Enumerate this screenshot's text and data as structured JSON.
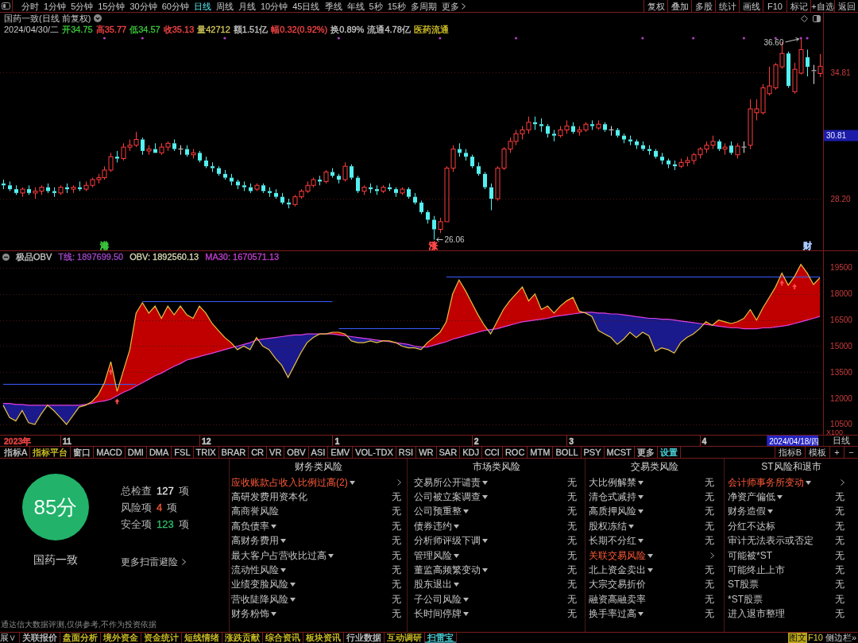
{
  "toolbar": {
    "periods": [
      {
        "label": "分时",
        "selected": false
      },
      {
        "label": "1分钟",
        "selected": false
      },
      {
        "label": "5分钟",
        "selected": false
      },
      {
        "label": "15分钟",
        "selected": false
      },
      {
        "label": "30分钟",
        "selected": false
      },
      {
        "label": "60分钟",
        "selected": false
      },
      {
        "label": "日线",
        "selected": true
      },
      {
        "label": "周线",
        "selected": false
      },
      {
        "label": "月线",
        "selected": false
      },
      {
        "label": "10分钟",
        "selected": false
      },
      {
        "label": "45日线",
        "selected": false
      },
      {
        "label": "季线",
        "selected": false
      },
      {
        "label": "年线",
        "selected": false
      },
      {
        "label": "5秒",
        "selected": false
      },
      {
        "label": "15秒",
        "selected": false
      },
      {
        "label": "多周期",
        "selected": false
      }
    ],
    "more": "更多",
    "actions": [
      "复权",
      "叠加",
      "多股",
      "统计",
      "画线",
      "F10",
      "标记",
      "+自选",
      "返回"
    ]
  },
  "price_panel": {
    "title": "国药一致(日线 前复权)",
    "date": "2024/04/30/二",
    "quote": [
      {
        "text": "开34.75",
        "color": "#3cc83c"
      },
      {
        "text": "高35.77",
        "color": "#ff4646"
      },
      {
        "text": "低34.57",
        "color": "#3cc83c"
      },
      {
        "text": "收35.13",
        "color": "#ff4646"
      },
      {
        "text": "量42712",
        "color": "#d2c85a"
      },
      {
        "text": "额1.51亿",
        "color": "#c8c8c8"
      },
      {
        "text": "幅0.32(0.92%)",
        "color": "#ff4646"
      },
      {
        "text": "换0.89%",
        "color": "#c8c8c8"
      },
      {
        "text": "流通4.78亿",
        "color": "#c8c8c8"
      },
      {
        "text": "医药流通",
        "color": "#d8c828"
      }
    ],
    "event_marks": [
      {
        "label": "港",
        "color": "#3cc83c"
      },
      {
        "label": "涨",
        "color": "#ff4646"
      },
      {
        "label": "财",
        "color": "#a8c8ff"
      }
    ],
    "cursor_price": "30.81",
    "chart_data": {
      "type": "candlestick",
      "ylim": [
        25.5,
        37.93
      ],
      "yticks": [
        {
          "value": 28.2,
          "label": "28.20"
        },
        {
          "value": 34.81,
          "label": "34.81"
        }
      ],
      "grid": true,
      "annotations": [
        "36.60",
        "26.06"
      ],
      "ohlc": [
        [
          29.0,
          29.2,
          28.7,
          28.9
        ],
        [
          28.9,
          29.1,
          28.6,
          28.7
        ],
        [
          28.7,
          28.9,
          28.4,
          28.5
        ],
        [
          28.5,
          28.8,
          28.3,
          28.7
        ],
        [
          28.7,
          28.9,
          28.4,
          28.5
        ],
        [
          28.5,
          28.8,
          28.2,
          28.6
        ],
        [
          28.6,
          28.9,
          28.4,
          28.8
        ],
        [
          28.8,
          29.0,
          28.5,
          28.6
        ],
        [
          28.6,
          28.8,
          28.3,
          28.5
        ],
        [
          28.5,
          28.9,
          28.4,
          28.8
        ],
        [
          28.8,
          29.0,
          28.5,
          28.7
        ],
        [
          28.7,
          28.9,
          28.5,
          28.8
        ],
        [
          28.8,
          29.1,
          28.6,
          28.7
        ],
        [
          28.7,
          29.1,
          28.6,
          28.9
        ],
        [
          28.9,
          29.3,
          28.8,
          29.2
        ],
        [
          29.2,
          29.5,
          29.0,
          29.3
        ],
        [
          29.3,
          29.9,
          29.2,
          29.7
        ],
        [
          29.7,
          30.6,
          29.6,
          30.4
        ],
        [
          30.4,
          30.7,
          30.1,
          30.3
        ],
        [
          30.3,
          31.1,
          30.2,
          30.9
        ],
        [
          30.9,
          31.3,
          30.7,
          31.0
        ],
        [
          31.0,
          31.7,
          30.9,
          31.3
        ],
        [
          31.3,
          31.4,
          30.5,
          30.7
        ],
        [
          30.7,
          31.0,
          30.5,
          30.8
        ],
        [
          30.8,
          31.1,
          30.6,
          30.6
        ],
        [
          30.6,
          31.1,
          30.5,
          30.9
        ],
        [
          30.9,
          31.2,
          30.7,
          31.1
        ],
        [
          31.1,
          31.3,
          30.7,
          30.8
        ],
        [
          30.8,
          31.0,
          30.5,
          30.8
        ],
        [
          30.8,
          31.0,
          30.4,
          30.5
        ],
        [
          30.5,
          30.8,
          30.3,
          30.6
        ],
        [
          30.6,
          30.7,
          30.1,
          30.2
        ],
        [
          30.2,
          30.4,
          29.8,
          29.9
        ],
        [
          29.9,
          30.1,
          29.6,
          29.8
        ],
        [
          29.8,
          29.9,
          29.4,
          29.5
        ],
        [
          29.5,
          29.7,
          29.2,
          29.3
        ],
        [
          29.3,
          29.5,
          28.9,
          29.1
        ],
        [
          29.1,
          29.2,
          28.7,
          28.9
        ],
        [
          28.9,
          29.1,
          28.6,
          28.8
        ],
        [
          28.8,
          29.0,
          28.5,
          28.6
        ],
        [
          28.7,
          29.0,
          28.6,
          28.9
        ],
        [
          28.9,
          29.0,
          28.5,
          28.6
        ],
        [
          28.6,
          28.8,
          28.3,
          28.5
        ],
        [
          28.5,
          28.7,
          28.2,
          28.3
        ],
        [
          28.3,
          28.5,
          27.9,
          28.0
        ],
        [
          28.0,
          28.2,
          27.7,
          27.9
        ],
        [
          27.9,
          28.4,
          27.8,
          28.3
        ],
        [
          28.3,
          28.7,
          28.2,
          28.6
        ],
        [
          28.6,
          29.1,
          28.5,
          28.9
        ],
        [
          28.9,
          29.3,
          28.8,
          29.2
        ],
        [
          29.2,
          29.4,
          28.9,
          29.1
        ],
        [
          29.1,
          29.7,
          29.0,
          29.6
        ],
        [
          29.6,
          29.8,
          29.3,
          29.4
        ],
        [
          29.4,
          29.5,
          29.0,
          29.2
        ],
        [
          29.2,
          30.1,
          29.1,
          29.9
        ],
        [
          29.9,
          30.0,
          29.2,
          29.3
        ],
        [
          29.3,
          29.4,
          28.5,
          28.6
        ],
        [
          28.6,
          28.9,
          28.4,
          28.8
        ],
        [
          28.8,
          29.0,
          28.5,
          28.7
        ],
        [
          28.7,
          28.9,
          28.4,
          28.6
        ],
        [
          28.6,
          28.9,
          28.5,
          28.8
        ],
        [
          28.8,
          29.0,
          28.6,
          28.7
        ],
        [
          28.7,
          28.8,
          28.3,
          28.5
        ],
        [
          28.5,
          28.8,
          28.4,
          28.7
        ],
        [
          28.7,
          28.8,
          28.2,
          28.3
        ],
        [
          28.3,
          28.5,
          27.9,
          28.0
        ],
        [
          28.0,
          28.1,
          27.4,
          27.5
        ],
        [
          27.5,
          27.6,
          26.9,
          27.1
        ],
        [
          27.1,
          27.3,
          26.06,
          26.6
        ],
        [
          26.6,
          27.2,
          26.4,
          27.0
        ],
        [
          27.0,
          29.9,
          27.0,
          29.8
        ],
        [
          29.8,
          31.0,
          29.6,
          30.8
        ],
        [
          30.8,
          31.1,
          30.4,
          30.6
        ],
        [
          30.6,
          30.8,
          30.2,
          30.4
        ],
        [
          30.4,
          30.5,
          29.8,
          29.9
        ],
        [
          29.9,
          30.1,
          29.4,
          29.5
        ],
        [
          29.5,
          29.6,
          28.7,
          28.8
        ],
        [
          28.8,
          29.0,
          27.6,
          28.2
        ],
        [
          28.2,
          29.9,
          28.1,
          29.8
        ],
        [
          29.8,
          30.9,
          29.7,
          30.8
        ],
        [
          30.8,
          31.4,
          30.6,
          31.2
        ],
        [
          31.2,
          31.8,
          31.0,
          31.6
        ],
        [
          31.6,
          32.0,
          31.3,
          31.8
        ],
        [
          31.8,
          32.5,
          31.6,
          32.2
        ],
        [
          32.2,
          32.5,
          31.8,
          32.1
        ],
        [
          32.1,
          32.4,
          31.7,
          32.0
        ],
        [
          32.0,
          32.1,
          31.4,
          31.6
        ],
        [
          31.6,
          31.8,
          31.2,
          31.5
        ],
        [
          31.5,
          32.0,
          31.4,
          31.8
        ],
        [
          31.8,
          32.3,
          31.6,
          32.0
        ],
        [
          32.0,
          32.2,
          31.6,
          31.7
        ],
        [
          31.7,
          32.0,
          31.5,
          31.8
        ],
        [
          31.8,
          32.2,
          31.7,
          32.1
        ],
        [
          32.1,
          32.3,
          31.8,
          32.0
        ],
        [
          31.9,
          32.3,
          31.8,
          32.1
        ],
        [
          32.1,
          32.2,
          31.7,
          31.8
        ],
        [
          31.8,
          32.0,
          31.5,
          31.8
        ],
        [
          31.8,
          31.9,
          31.4,
          31.5
        ],
        [
          31.5,
          31.6,
          31.1,
          31.3
        ],
        [
          31.3,
          31.5,
          31.0,
          31.2
        ],
        [
          31.2,
          31.3,
          30.8,
          31.0
        ],
        [
          31.0,
          31.2,
          30.7,
          30.8
        ],
        [
          30.8,
          31.0,
          30.5,
          30.7
        ],
        [
          30.7,
          30.8,
          30.3,
          30.4
        ],
        [
          30.4,
          30.6,
          30.0,
          30.2
        ],
        [
          30.2,
          30.3,
          29.8,
          30.0
        ],
        [
          30.0,
          30.2,
          29.7,
          29.9
        ],
        [
          29.9,
          30.3,
          29.8,
          30.1
        ],
        [
          30.1,
          30.4,
          29.9,
          30.2
        ],
        [
          30.2,
          30.6,
          30.0,
          30.5
        ],
        [
          30.5,
          30.9,
          30.3,
          30.8
        ],
        [
          30.8,
          31.2,
          30.6,
          31.0
        ],
        [
          31.0,
          31.5,
          30.8,
          31.2
        ],
        [
          31.2,
          31.3,
          30.7,
          30.8
        ],
        [
          30.8,
          31.1,
          30.5,
          30.9
        ],
        [
          30.98,
          31.2,
          30.5,
          30.6
        ],
        [
          30.5,
          31.1,
          30.3,
          30.95
        ],
        [
          30.9,
          31.2,
          30.6,
          30.9
        ],
        [
          31.0,
          33.4,
          30.8,
          32.9
        ],
        [
          32.7,
          33.4,
          32.3,
          32.9
        ],
        [
          32.7,
          34.2,
          32.6,
          34.0
        ],
        [
          33.7,
          35.1,
          33.6,
          34.1
        ],
        [
          34.0,
          35.3,
          33.9,
          35.2
        ],
        [
          35.1,
          36.4,
          35.0,
          35.8
        ],
        [
          35.8,
          35.9,
          34.0,
          34.1
        ],
        [
          33.8,
          35.3,
          33.7,
          34.97
        ],
        [
          34.77,
          36.6,
          34.7,
          36.0
        ],
        [
          35.6,
          36.0,
          34.6,
          35.1
        ],
        [
          34.9,
          35.2,
          34.2,
          34.9
        ],
        [
          34.75,
          35.77,
          34.57,
          35.13
        ]
      ]
    }
  },
  "obv_panel": {
    "legend": [
      {
        "text": "极品OBV",
        "color": "#c8c8c8"
      },
      {
        "text": "T线: 1897699.50",
        "color": "#a048c8"
      },
      {
        "text": "OBV: 1892560.13",
        "color": "#d8d8b4"
      },
      {
        "text": "MA30: 1670571.13",
        "color": "#c040d0"
      }
    ],
    "chart_data": {
      "type": "line",
      "ylim": [
        9906,
        20459
      ],
      "yticks": [
        10500,
        12000,
        13500,
        15000,
        16500,
        18000,
        19500
      ],
      "ylabel": "X100",
      "grid": true,
      "series": [
        {
          "type": "step",
          "color": "#3a5cff",
          "values": [
            12830,
            12830,
            12830,
            12830,
            12830,
            12830,
            12830,
            12830,
            12830,
            12830,
            12830,
            12830,
            12830,
            12830,
            12830,
            12830,
            12830,
            12830,
            12830,
            12830,
            12830,
            12830,
            17580,
            17580,
            17580,
            17580,
            17580,
            17580,
            17580,
            17580,
            17580,
            17580,
            17580,
            17580,
            17580,
            17580,
            17580,
            17580,
            17580,
            17580,
            17580,
            17580,
            17580,
            17580,
            17580,
            17580,
            17580,
            17580,
            17580,
            17580,
            17580,
            17580,
            17580,
            16030,
            16030,
            16030,
            16030,
            16030,
            16030,
            16030,
            16030,
            16030,
            16030,
            16030,
            16030,
            16030,
            16030,
            16030,
            16030,
            16030,
            18980,
            18980,
            18980,
            18980,
            18980,
            18980,
            18980,
            18980,
            18980,
            18980,
            18980,
            18980,
            18980,
            18980,
            18980,
            18980,
            18980,
            18980,
            18980,
            18980,
            18980,
            18980,
            18980,
            18980,
            18980,
            18980,
            18980,
            18980,
            18980,
            18980,
            18980,
            18980,
            18980,
            18980,
            18980,
            18980,
            18980,
            18980,
            18980,
            18980,
            18980,
            18980,
            18980,
            18980,
            18980,
            18980,
            18980,
            18980,
            18980,
            18980,
            18980,
            18980,
            18980,
            18980,
            18980,
            18980,
            18980,
            18980,
            18980,
            18980
          ]
        },
        {
          "type": "line",
          "color": "#e8c040",
          "values": [
            11600,
            10900,
            10700,
            11300,
            10600,
            10500,
            11100,
            11600,
            11300,
            10900,
            10500,
            11000,
            11500,
            11600,
            11800,
            12200,
            12900,
            14100,
            12400,
            13600,
            14800,
            16900,
            17500,
            16900,
            17300,
            16600,
            17300,
            16800,
            17300,
            16800,
            16600,
            17300,
            16900,
            16300,
            15900,
            15500,
            15200,
            14800,
            15000,
            14800,
            15500,
            15000,
            14800,
            14300,
            13900,
            13200,
            13900,
            14600,
            15200,
            15500,
            15700,
            15700,
            15800,
            15800,
            15700,
            15300,
            15200,
            15200,
            15300,
            15200,
            15300,
            15300,
            15200,
            15000,
            14900,
            14900,
            14800,
            15200,
            15500,
            15800,
            16400,
            18000,
            18800,
            18200,
            17500,
            16800,
            16200,
            15700,
            16400,
            17100,
            17600,
            18000,
            18400,
            17600,
            18000,
            17100,
            17300,
            16900,
            17300,
            17600,
            17800,
            17000,
            16900,
            16700,
            15900,
            15700,
            15500,
            15100,
            15400,
            15800,
            15500,
            15800,
            15600,
            14700,
            14900,
            14800,
            14600,
            15200,
            15500,
            15700,
            16000,
            16400,
            16200,
            16500,
            16400,
            16300,
            16400,
            16600,
            17100,
            16500,
            17200,
            17800,
            18400,
            19200,
            18500,
            19000,
            19700,
            19200,
            18540,
            18930
          ]
        },
        {
          "type": "line",
          "color": "#e040e0",
          "values": [
            11700,
            11700,
            11650,
            11650,
            11600,
            11600,
            11600,
            11600,
            11600,
            11600,
            11600,
            11600,
            11600,
            11650,
            11700,
            11800,
            11850,
            11950,
            12150,
            12350,
            12500,
            12700,
            12900,
            13100,
            13300,
            13450,
            13650,
            13850,
            14000,
            14200,
            14300,
            14400,
            14500,
            14600,
            14700,
            14800,
            14900,
            15000,
            15100,
            15200,
            15350,
            15400,
            15450,
            15500,
            15550,
            15600,
            15650,
            15650,
            15700,
            15700,
            15700,
            15700,
            15700,
            15650,
            15600,
            15550,
            15500,
            15450,
            15400,
            15350,
            15300,
            15250,
            15200,
            15150,
            15100,
            15000,
            14950,
            14950,
            15050,
            15150,
            15250,
            15400,
            15500,
            15600,
            15700,
            15800,
            15900,
            15950,
            16000,
            16100,
            16200,
            16300,
            16400,
            16450,
            16500,
            16550,
            16600,
            16700,
            16750,
            16800,
            16850,
            16900,
            16950,
            16950,
            16900,
            16900,
            16850,
            16850,
            16800,
            16750,
            16700,
            16650,
            16600,
            16600,
            16550,
            16550,
            16500,
            16450,
            16400,
            16350,
            16300,
            16250,
            16200,
            16150,
            16100,
            16050,
            16050,
            16000,
            16000,
            16000,
            16050,
            16050,
            16100,
            16150,
            16200,
            16300,
            16400,
            16500,
            16600,
            16710
          ]
        }
      ]
    }
  },
  "time_axis": {
    "labels": [
      {
        "text": "2023年",
        "color": "#e04040"
      },
      {
        "text": "11",
        "color": "#c8c8c8"
      },
      {
        "text": "12",
        "color": "#c8c8c8"
      },
      {
        "text": "1",
        "color": "#c8c8c8"
      },
      {
        "text": "2",
        "color": "#c8c8c8"
      },
      {
        "text": "3",
        "color": "#c8c8c8"
      },
      {
        "text": "4",
        "color": "#c8c8c8"
      }
    ],
    "cursor_date": "2024/04/18/四",
    "period": "日线"
  },
  "indicator_tabs": {
    "left": [
      {
        "label": "指标A",
        "color": "#c8c8c8"
      },
      {
        "label": "指标平台",
        "color": "#d8c828"
      },
      {
        "label": "窗口",
        "color": "#c8c8c8"
      },
      {
        "label": "MACD",
        "color": "#c8c8c8"
      },
      {
        "label": "DMI",
        "color": "#c8c8c8"
      },
      {
        "label": "DMA",
        "color": "#c8c8c8"
      },
      {
        "label": "FSL",
        "color": "#c8c8c8"
      },
      {
        "label": "TRIX",
        "color": "#c8c8c8"
      },
      {
        "label": "BRAR",
        "color": "#c8c8c8"
      },
      {
        "label": "CR",
        "color": "#c8c8c8"
      },
      {
        "label": "VR",
        "color": "#c8c8c8"
      },
      {
        "label": "OBV",
        "color": "#c8c8c8"
      },
      {
        "label": "ASI",
        "color": "#c8c8c8"
      },
      {
        "label": "EMV",
        "color": "#c8c8c8"
      },
      {
        "label": "VOL-TDX",
        "color": "#c8c8c8"
      },
      {
        "label": "RSI",
        "color": "#c8c8c8"
      },
      {
        "label": "WR",
        "color": "#c8c8c8"
      },
      {
        "label": "SAR",
        "color": "#c8c8c8"
      },
      {
        "label": "KDJ",
        "color": "#c8c8c8"
      },
      {
        "label": "CCI",
        "color": "#c8c8c8"
      },
      {
        "label": "ROC",
        "color": "#c8c8c8"
      },
      {
        "label": "MTM",
        "color": "#c8c8c8"
      },
      {
        "label": "BOLL",
        "color": "#c8c8c8"
      },
      {
        "label": "PSY",
        "color": "#c8c8c8"
      },
      {
        "label": "MCST",
        "color": "#c8c8c8"
      },
      {
        "label": "更多",
        "color": "#c8c8c8"
      },
      {
        "label": "设置",
        "color": "#50e0e8"
      }
    ],
    "right": [
      "指标B",
      "模板",
      "+",
      "−"
    ]
  },
  "scan": {
    "score": "85分",
    "name": "国药一致",
    "stats": [
      {
        "label": "总检查",
        "value": "127",
        "unit": "项",
        "color": "#e6e6e6"
      },
      {
        "label": "风险项",
        "value": "4",
        "unit": "项",
        "color": "#ff5a36"
      },
      {
        "label": "安全项",
        "value": "123",
        "unit": "项",
        "color": "#2fbf6a"
      }
    ],
    "more": "更多扫雷避险",
    "disclaimer": "通达信大数据评测,仅供参考,不作为投资依据",
    "columns": [
      {
        "title": "财务类风险",
        "items": [
          {
            "label": "应收账款占收入比例过高(2)",
            "dropdown": true,
            "risk": true
          },
          {
            "label": "高研发费用资本化",
            "dropdown": false,
            "risk": false,
            "status": "无"
          },
          {
            "label": "高商誉风险",
            "dropdown": false,
            "risk": false,
            "status": "无"
          },
          {
            "label": "高负债率",
            "dropdown": true,
            "risk": false,
            "status": "无"
          },
          {
            "label": "高财务费用",
            "dropdown": true,
            "risk": false,
            "status": "无"
          },
          {
            "label": "最大客户占营收比过高",
            "dropdown": true,
            "risk": false,
            "status": "无"
          },
          {
            "label": "流动性风险",
            "dropdown": true,
            "risk": false,
            "status": "无"
          },
          {
            "label": "业绩变脸风险",
            "dropdown": true,
            "risk": false,
            "status": "无"
          },
          {
            "label": "营收陡降风险",
            "dropdown": true,
            "risk": false,
            "status": "无"
          },
          {
            "label": "财务粉饰",
            "dropdown": true,
            "risk": false,
            "status": "无"
          }
        ]
      },
      {
        "title": "市场类风险",
        "items": [
          {
            "label": "交易所公开谴责",
            "dropdown": true,
            "risk": false,
            "status": "无"
          },
          {
            "label": "公司被立案调查",
            "dropdown": true,
            "risk": false,
            "status": "无"
          },
          {
            "label": "公司预重整",
            "dropdown": true,
            "risk": false,
            "status": "无"
          },
          {
            "label": "债券违约",
            "dropdown": true,
            "risk": false,
            "status": "无"
          },
          {
            "label": "分析师评级下调",
            "dropdown": true,
            "risk": false,
            "status": "无"
          },
          {
            "label": "管理风险",
            "dropdown": true,
            "risk": false,
            "status": "无"
          },
          {
            "label": "董监高频繁变动",
            "dropdown": true,
            "risk": false,
            "status": "无"
          },
          {
            "label": "股东退出",
            "dropdown": true,
            "risk": false,
            "status": "无"
          },
          {
            "label": "子公司风险",
            "dropdown": true,
            "risk": false,
            "status": "无"
          },
          {
            "label": "长时间停牌",
            "dropdown": true,
            "risk": false,
            "status": "无"
          }
        ]
      },
      {
        "title": "交易类风险",
        "items": [
          {
            "label": "大比例解禁",
            "dropdown": true,
            "risk": false,
            "status": "无"
          },
          {
            "label": "清仓式减持",
            "dropdown": true,
            "risk": false,
            "status": "无"
          },
          {
            "label": "高质押风险",
            "dropdown": true,
            "risk": false,
            "status": "无"
          },
          {
            "label": "股权冻结",
            "dropdown": true,
            "risk": false,
            "status": "无"
          },
          {
            "label": "长期不分红",
            "dropdown": true,
            "risk": false,
            "status": "无"
          },
          {
            "label": "关联交易风险",
            "dropdown": true,
            "risk": true
          },
          {
            "label": "北上资金卖出",
            "dropdown": true,
            "risk": false,
            "status": "无"
          },
          {
            "label": "大宗交易折价",
            "dropdown": false,
            "risk": false,
            "status": "无"
          },
          {
            "label": "融资高融卖率",
            "dropdown": false,
            "risk": false,
            "status": "无"
          },
          {
            "label": "换手率过高",
            "dropdown": true,
            "risk": false,
            "status": "无"
          }
        ]
      },
      {
        "title": "ST风险和退市",
        "items": [
          {
            "label": "会计师事务所变动",
            "dropdown": true,
            "risk": true
          },
          {
            "label": "净资产偏低",
            "dropdown": true,
            "risk": false,
            "status": "无"
          },
          {
            "label": "财务造假",
            "dropdown": true,
            "risk": false,
            "status": "无"
          },
          {
            "label": "分红不达标",
            "dropdown": false,
            "risk": false,
            "status": "无"
          },
          {
            "label": "审计无法表示或否定",
            "dropdown": false,
            "risk": false,
            "status": "无"
          },
          {
            "label": "可能被*ST",
            "dropdown": false,
            "risk": false,
            "status": "无"
          },
          {
            "label": "可能终止上市",
            "dropdown": false,
            "risk": false,
            "status": "无"
          },
          {
            "label": "ST股票",
            "dropdown": false,
            "risk": false,
            "status": "无"
          },
          {
            "label": "*ST股票",
            "dropdown": false,
            "risk": false,
            "status": "无"
          },
          {
            "label": "进入退市整理",
            "dropdown": false,
            "risk": false,
            "status": "无"
          }
        ]
      }
    ]
  },
  "bottom_tabs": {
    "expand": "展∨",
    "tabs": [
      {
        "label": "关联报价",
        "selected": false,
        "color": "#c8c8c8"
      },
      {
        "label": "盘面分析",
        "selected": false,
        "color": "#d8c828"
      },
      {
        "label": "境外资金",
        "selected": false,
        "color": "#d8c828"
      },
      {
        "label": "资金统计",
        "selected": false,
        "color": "#d8c828"
      },
      {
        "label": "短线情绪",
        "selected": false,
        "color": "#d8c828"
      },
      {
        "label": "涨跌贡献",
        "selected": false,
        "color": "#d8c828"
      },
      {
        "label": "综合资讯",
        "selected": false,
        "color": "#d8c828"
      },
      {
        "label": "板块资讯",
        "selected": false,
        "color": "#d8c828"
      },
      {
        "label": "行业数据",
        "selected": false,
        "color": "#c8c8c8"
      },
      {
        "label": "互动调研",
        "selected": false,
        "color": "#d8c828"
      },
      {
        "label": "扫雷宝",
        "selected": true,
        "color": "#50e0e8"
      }
    ],
    "f10": {
      "badge": "图文",
      "label": "F10"
    },
    "sidebar": "侧边栏»"
  }
}
